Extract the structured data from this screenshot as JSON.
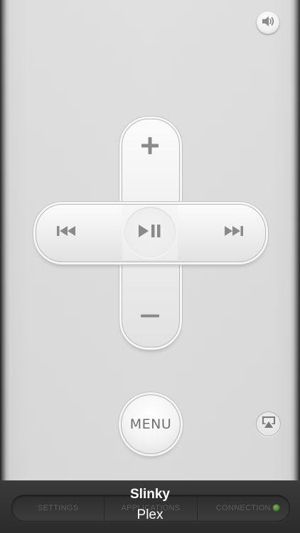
{
  "remote": {
    "menu_label": "MENU",
    "icons": {
      "volume": "speaker-icon",
      "up": "plus-icon",
      "down": "minus-icon",
      "left": "rewind-icon",
      "right": "fast-forward-icon",
      "center": "play-pause-icon",
      "airplay": "airplay-icon"
    }
  },
  "now_playing": {
    "title": "Slinky",
    "subtitle": "Plex"
  },
  "tab_bar": {
    "tabs": [
      {
        "label": "SETTINGS"
      },
      {
        "label": "APPLICATIONS"
      },
      {
        "label": "CONNECTION"
      }
    ],
    "status_color": "#5e9a38"
  },
  "colors": {
    "body": "#dedede",
    "glyph": "#8a8a8a",
    "bar": "#333333"
  }
}
